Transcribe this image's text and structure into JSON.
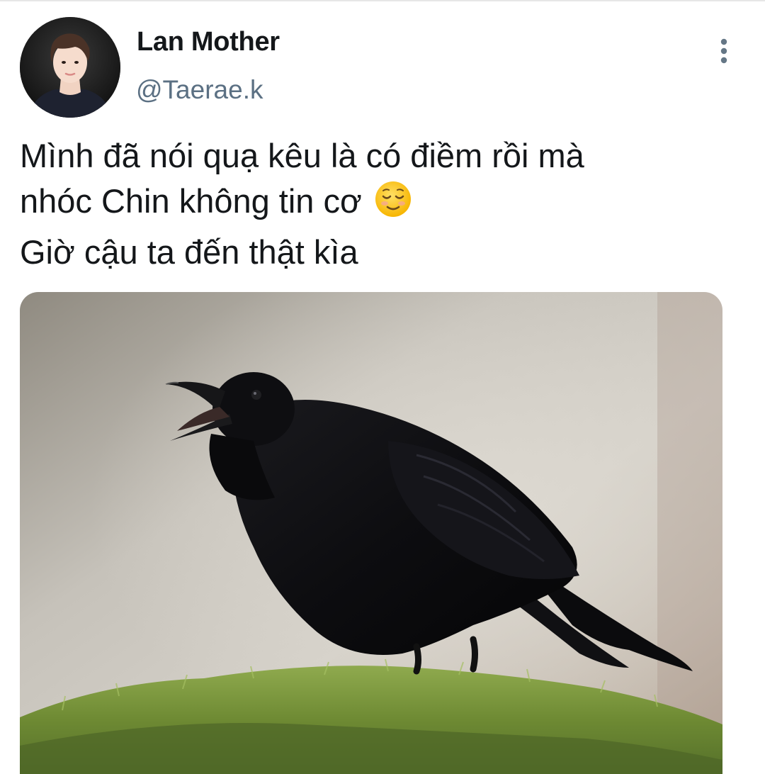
{
  "tweet": {
    "author": {
      "display_name": "Lan Mother",
      "handle": "@Taerae.k",
      "avatar_icon": "profile-photo"
    },
    "text_lines": [
      "Mình đã nói quạ kêu là có điềm rồi mà",
      "nhóc Chin không tin cơ",
      "Giờ cậu ta đến thật kìa"
    ],
    "inline_emoji": "relieved-face-emoji",
    "more_icon": "vertical-ellipsis-icon",
    "media": {
      "type": "photo",
      "subject": "black raven calling on mossy ground"
    }
  },
  "colors": {
    "text_primary": "#14171a",
    "text_secondary": "#5b7083",
    "background": "#ffffff"
  }
}
